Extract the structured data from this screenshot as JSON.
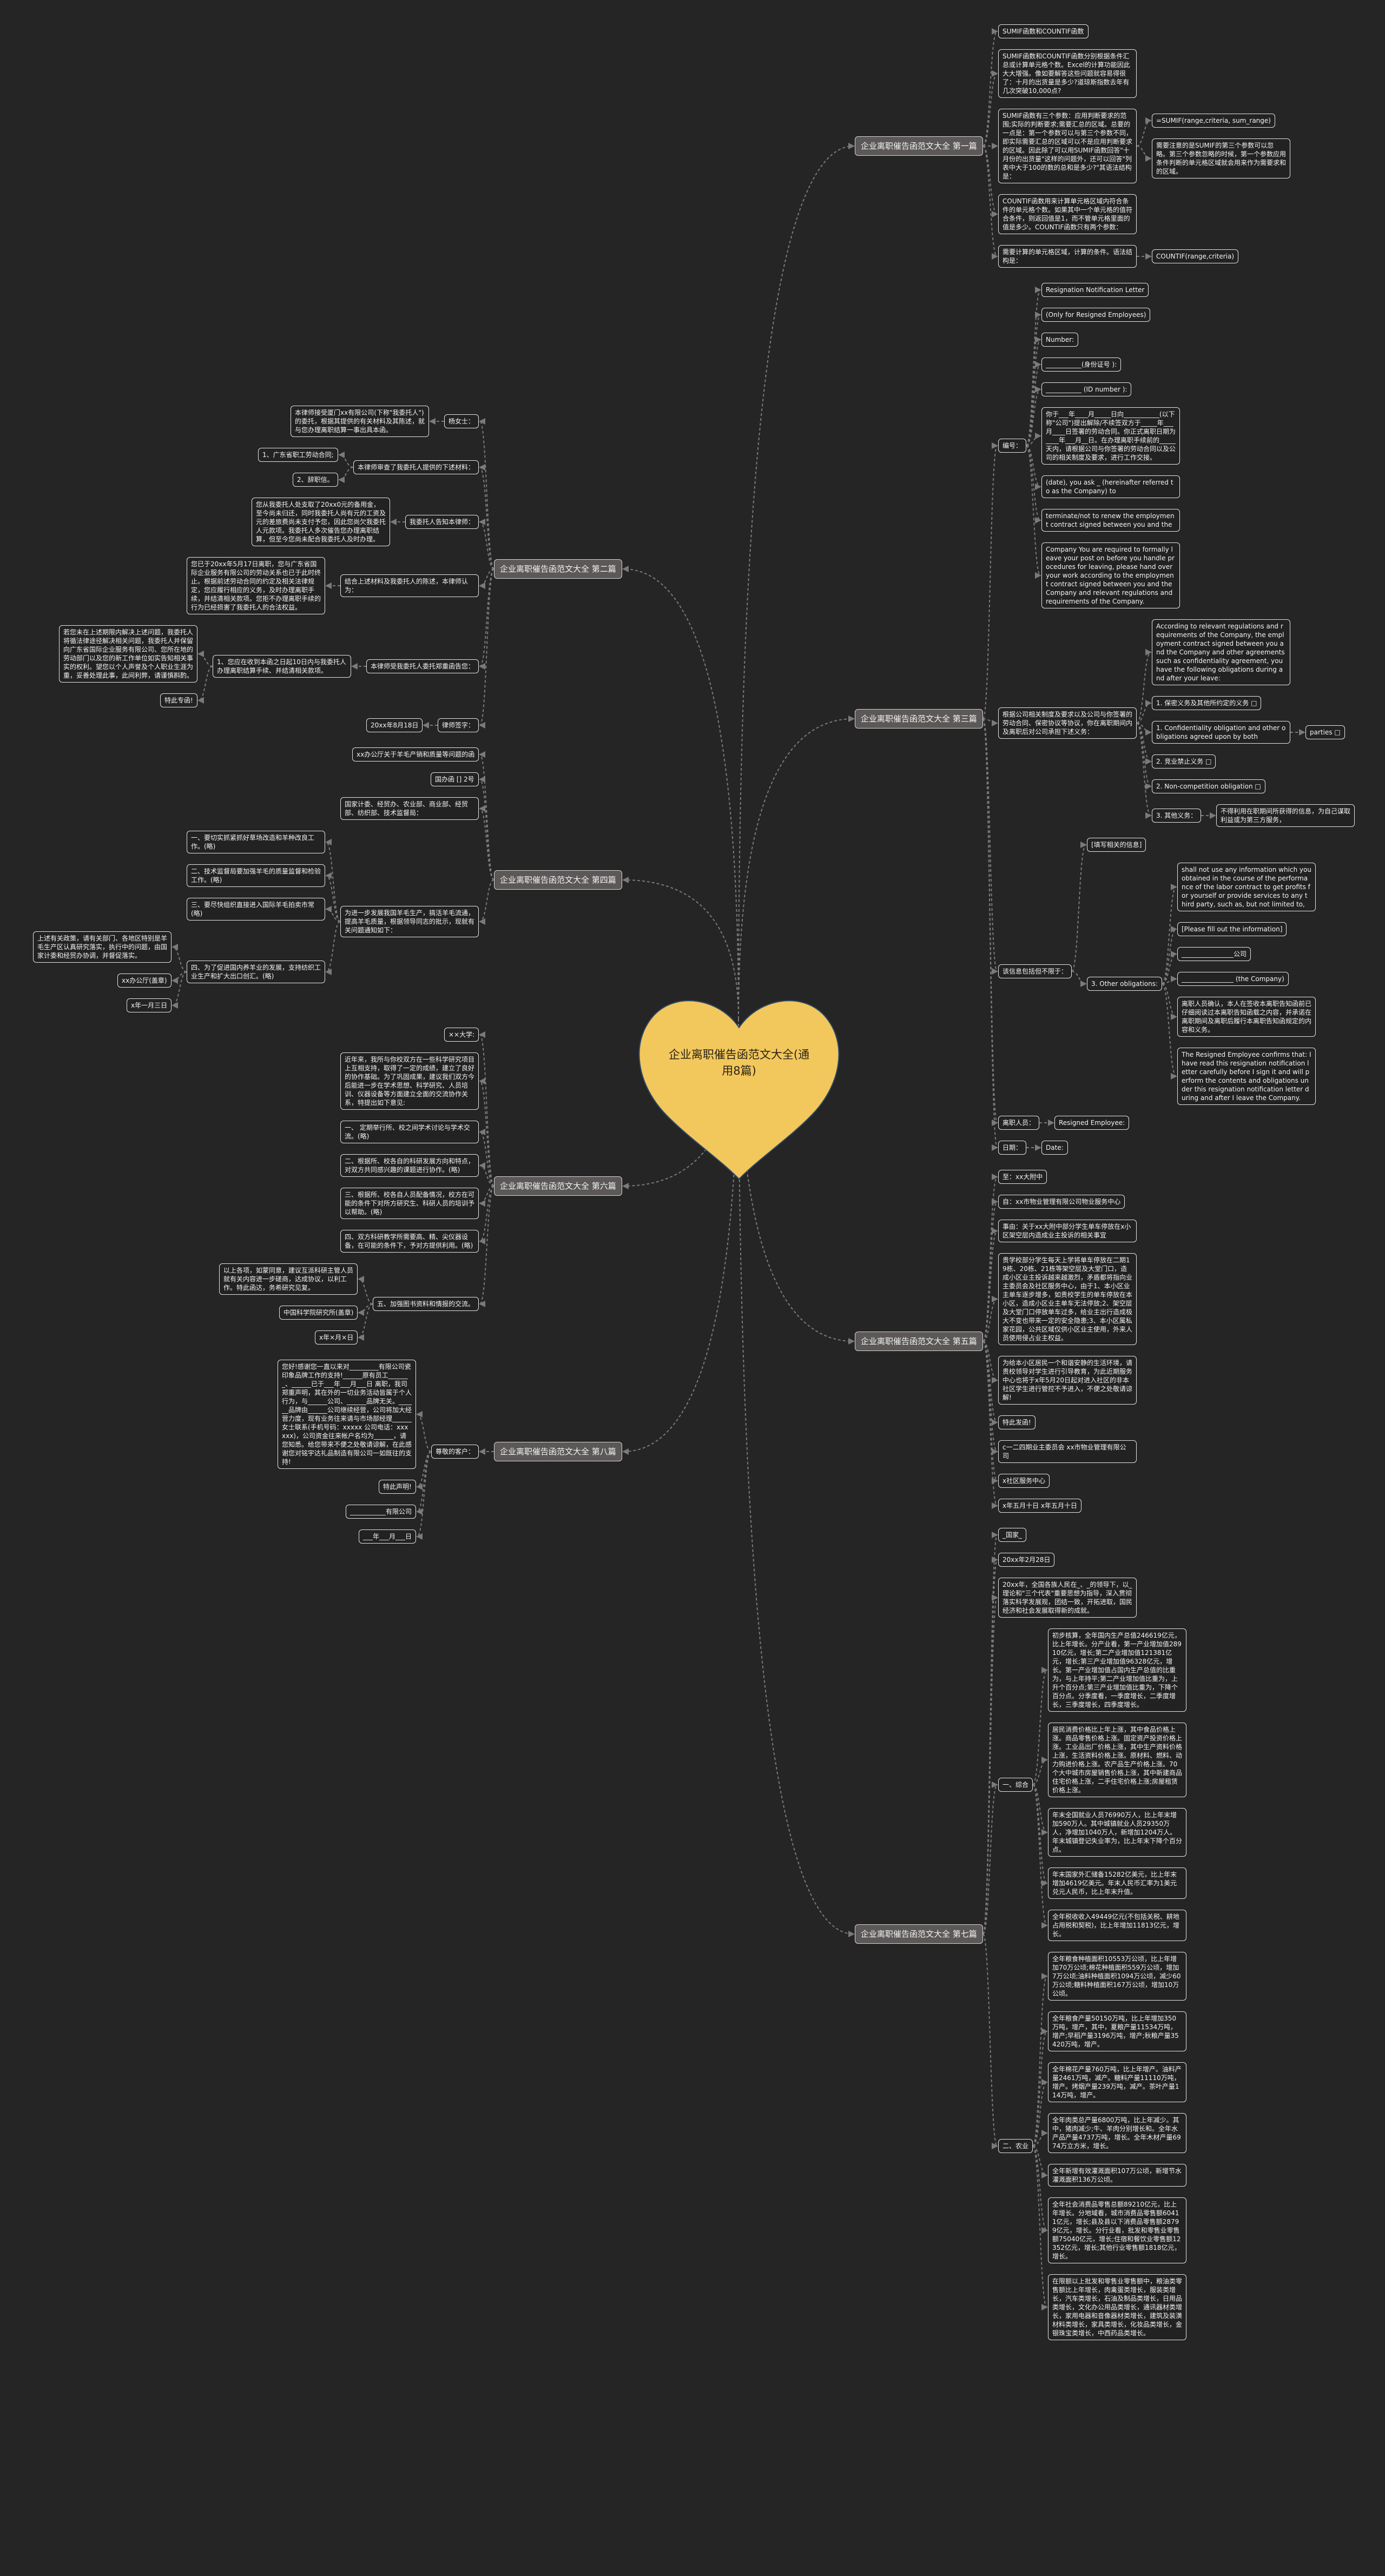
{
  "colors": {
    "background": "#252525",
    "central_fill": "#f2c75c",
    "branch_fill": "#5b5857",
    "node_border": "#e6e6e6",
    "connector": "#7a7a7a"
  },
  "mindmap": {
    "root": "企业离职催告函范文大全(通用8篇)",
    "right": [
      {
        "text": "企业离职催告函范文大全 第一篇",
        "children": [
          {
            "text": "SUMIF函数和COUNTIF函数"
          },
          {
            "text": "SUMIF函数和COUNTIF函数分别根据条件汇总或计算单元格个数。Excel的计算功能因此大大增强。像如要解答这些问题就容易得很了：十月的出货量是多少?道琼斯指数去年有几次突破10,000点?"
          },
          {
            "text": "SUMIF函数有三个参数：应用判断要求的范围;实际的判断要求;需要汇总的区域。总要的一点是：第一个参数可以与第三个参数不同，即实际需要汇总的区域可以不是应用判断要求的区域。因此除了可以用SUMIF函数回答\"十月份的出货量\"这样的问题外，还可以回答\"列表中大于100的数的总和是多少?\"其语法结构是：",
            "children": [
              {
                "text": "=SUMIF(range,criteria, sum_range)"
              },
              {
                "text": "需要注意的是SUMIF的第三个参数可以忽略。第三个参数忽略的时候，第一个参数应用条件判断的单元格区域就会用来作为需要求和的区域。"
              }
            ]
          },
          {
            "text": "COUNTIF函数用来计算单元格区域内符合条件的单元格个数。如果其中一个单元格的值符合条件，则返回值是1，而不管单元格里面的值是多少。COUNTIF函数只有两个参数："
          },
          {
            "text": "需要计算的单元格区域，计算的条件。语法结构是：",
            "children": [
              {
                "text": "COUNTIF(range,criteria)"
              }
            ]
          }
        ]
      },
      {
        "text": "企业离职催告函范文大全 第三篇",
        "children": [
          {
            "text": "编号：",
            "children": [
              {
                "text": "Resignation Notification Letter"
              },
              {
                "text": "(Only for Resigned Employees)"
              },
              {
                "text": "Number:"
              },
              {
                "text": "___________(身份证号 ):"
              },
              {
                "text": "___________ (ID number ):"
              },
              {
                "text": "你于___年____月_____日向___________(以下称\"公司\")提出解除/不续签双方于_____年___月____日签署的劳动合同。你正式离职日期为____年___月__日。在办理离职手续前的_____天内，请根据公司与你签署的劳动合同以及公司的相关制度及要求，进行工作交接。"
              },
              {
                "text": "(date), you ask _ (hereinafter referred to as the Company) to"
              },
              {
                "text": "terminate/not to renew the employment contract signed between you and the"
              },
              {
                "text": "Company You are required to formally leave your post on before you handle procedures for leaving, please hand over your work according to the employment contract signed between you and the Company and relevant regulations and requirements of the Company."
              }
            ]
          },
          {
            "text": "根据公司相关制度及要求以及公司与你签署的劳动合同、保密协议等协议，你在离职期间内及离职后对公司承担下述义务：",
            "children": [
              {
                "text": "According to relevant regulations and requirements of the Company, the employment contract signed between you and the Company and other agreements such as confidentiality agreement, you have the following obligations during and after your leave:"
              },
              {
                "text": "1. 保密义务及其他所约定的义务 □"
              },
              {
                "text": "1. Confidentiality obligation and other obligations agreed upon by both",
                "children": [
                  {
                    "text": "parties □"
                  }
                ]
              },
              {
                "text": "2. 竞业禁止义务 □"
              },
              {
                "text": "2. Non-competition obligation □"
              },
              {
                "text": "3. 其他义务：",
                "children": [
                  {
                    "text": "不得利用在职期间所获得的信息，为自己谋取利益或为第三方服务，"
                  }
                ]
              }
            ]
          },
          {
            "text": "该信息包括但不限于：",
            "children": [
              {
                "text": "[填写相关的信息]"
              },
              {
                "text": "3. Other obligations:",
                "children": [
                  {
                    "text": " shall not use any information which you obtained in the course of the performance of the labor contract to get profits for yourself or provide services to any third party, such as, but not limited to,"
                  },
                  {
                    "text": "[Please fill out the information]"
                  },
                  {
                    "text": "________________公司"
                  },
                  {
                    "text": "________________ (the Company)"
                  },
                  {
                    "text": "离职人员确认，本人在签收本离职告知函前已仔细阅读过本离职告知函载之内容，并承诺在离职期间及离职后履行本离职告知函规定的内容和义务。"
                  },
                  {
                    "text": "The Resigned Employee confirms that: I have read this resignation notification letter carefully before I sign it and will perform the contents and obligations under this resignation notification letter during and after I leave the Company."
                  }
                ]
              }
            ]
          },
          {
            "text": "离职人员：",
            "children": [
              {
                "text": "Resigned Employee:"
              }
            ]
          },
          {
            "text": "日期：",
            "children": [
              {
                "text": "Date:"
              }
            ]
          }
        ]
      },
      {
        "text": "企业离职催告函范文大全 第五篇",
        "children": [
          {
            "text": "至：xx大附中"
          },
          {
            "text": "自：xx市物业管理有限公司物业服务中心"
          },
          {
            "text": "事由：关于xx大附中部分学生单车停放在x小区架空层内造成业主投诉的相关事宜"
          },
          {
            "text": "贵学校部分学生每天上学将单车停放在二期19栋、20栋、21栋等架空层及大堂门口，造成小区业主投诉越来越激烈，矛盾都将指向业主委员会及社区服务中心，由于1、本小区业主单车逐步增多，如贵校学生的单车停放在本小区，造成小区业主单车无法停放;2、架空层及大堂门口停放单车过多，给业主出行造成极大不变也带来一定的安全隐患;3、本小区属私家花园，公共区域仅供小区业主使用，外来人员使用侵占业主权益。"
          },
          {
            "text": "为给本小区居民一个和谐安静的生活环境，请贵校领导对学生进行引导教育，为此近期服务中心也将于x年5月20日起对进入社区的非本社区学生进行管控不予进入，不便之处敬请谅解!"
          },
          {
            "text": "特此发函!"
          },
          {
            "text": "c一二四期业主委员会 xx市物业管理有限公司"
          },
          {
            "text": "x社区服务中心"
          },
          {
            "text": "x年五月十日 x年五月十日"
          }
        ]
      },
      {
        "text": "企业离职催告函范文大全 第七篇",
        "children": [
          {
            "text": "_国家_"
          },
          {
            "text": "20xx年2月28日"
          },
          {
            "text": "20xx年，全国各族人民在_、_的领导下，以_理论和\"三个代表\"重要思想为指导，深入贯彻落实科学发展观，团结一致，开拓进取，国民经济和社会发展取得新的成就。"
          },
          {
            "text": "一、综合",
            "children": [
              {
                "text": "初步核算，全年国内生产总值246619亿元，比上年增长。分产业看，第一产业增加值28910亿元，增长;第二产业增加值121381亿元，增长;第三产业增加值96328亿元，增长。第一产业增加值占国内生产总值的比重为，与上年持平;第二产业增加值比重为，上升个百分点;第三产业增加值比重为，下降个百分点。分季度看，一季度增长，二季度增长，三季度增长，四季度增长。"
              },
              {
                "text": "居民消费价格比上年上涨，其中食品价格上涨。商品零售价格上涨。固定资产投资价格上涨。工业品出厂价格上涨，其中生产资料价格上涨，生活资料价格上涨。原材料、燃料、动力购进价格上涨。农产品生产价格上涨。70个大中城市房屋销售价格上涨，其中新建商品住宅价格上涨，二手住宅价格上涨;房屋租赁价格上涨。"
              },
              {
                "text": "年末全国就业人员76990万人，比上年末增加590万人。其中城镇就业人员29350万人，净增加1040万人，新增加1204万人。年末城镇登记失业率为，比上年末下降个百分点。"
              },
              {
                "text": "年末国家外汇储备15282亿美元，比上年末增加4619亿美元。年末人民币汇率为1美元兑元人民币，比上年末升值。"
              },
              {
                "text": "全年税收收入49449亿元(不包括关税、耕地占用税和契税)，比上年增加11813亿元，增长。"
              }
            ]
          },
          {
            "text": "二、农业",
            "children": [
              {
                "text": "全年粮食种植面积10553万公顷，比上年增加70万公顷;棉花种植面积559万公顷，增加7万公顷;油料种植面积1094万公顷，减少60万公顷;糖料种植面积167万公顷，增加10万公顷。"
              },
              {
                "text": "全年粮食产量50150万吨，比上年增加350万吨，增产，其中，夏粮产量11534万吨，增产;早稻产量3196万吨，增产;秋粮产量35420万吨，增产。"
              },
              {
                "text": "全年棉花产量760万吨，比上年增产。油料产量2461万吨，减产。糖料产量11110万吨，增产。烤烟产量239万吨，减产。茶叶产量114万吨，增产。"
              },
              {
                "text": "全年肉类总产量6800万吨，比上年减少。其中，猪肉减少;牛、羊肉分别增长和。全年水产品产量4737万吨，增长。全年木材产量6974万立方米，增长。"
              },
              {
                "text": "全年新增有效灌溉面积107万公顷，新增节水灌溉面积136万公顷。"
              },
              {
                "text": "全年社会消费品零售总额89210亿元，比上年增长。分地域看，城市消费品零售额60411亿元，增长;县及县以下消费品零售额28799亿元，增长。分行业看，批发和零售业零售额75040亿元，增长;住宿和餐饮业零售额12352亿元，增长;其他行业零售额1818亿元，增长。"
              },
              {
                "text": "在限额以上批发和零售业零售额中，粮油类零售额比上年增长，肉禽蛋类增长，服装类增长，汽车类增长，石油及制品类增长，日用品类增长，文化办公用品类增长，通讯器材类增长，家用电器和音像器材类增长，建筑及装潢材料类增长，家具类增长，化妆品类增长，金银珠宝类增长，中西药品类增长。"
              }
            ]
          }
        ]
      }
    ],
    "left": [
      {
        "text": "企业离职催告函范文大全 第二篇",
        "children": [
          {
            "text": "杨女士：",
            "children": [
              {
                "text": "本律师接受厦门xx有限公司(下称\"我委托人\")的委托，根据其提供的有关材料及其陈述，就与您办理离职结算一事出具本函。"
              }
            ]
          },
          {
            "text": "本律师审查了我委托人提供的下述材料：",
            "children": [
              {
                "text": "1、广东省职工劳动合同;"
              },
              {
                "text": "2、辞职信。"
              }
            ]
          },
          {
            "text": "我委托人告知本律师：",
            "children": [
              {
                "text": "您从我委托人处支取了20xx0元的备用金，至今尚未归还，同时我委托人尚有元的工资及元的差旅费尚未支付予您，因此您尚欠我委托人元款项。我委托人多次催告您办理离职结算，但至今您尚未配合我委托人及时办理。"
              }
            ]
          },
          {
            "text": "结合上述材料及我委托人的陈述，本律师认为：",
            "children": [
              {
                "text": "您已于20xx年5月17日离职，您与广东省国际企业服务有限公司的劳动关系也已于此时终止。根据前述劳动合同的约定及相关法律规定，您应履行相应的义务，及时办理离职手续，并结清相关款项。您拒不办理离职手续的行为已经损害了我委托人的合法权益。"
              }
            ]
          },
          {
            "text": "本律师受我委托人委托郑重函告您：",
            "children": [
              {
                "text": "1、您应在收到本函之日起10日内与我委托人办理离职结算手续、并结清相关款项。",
                "children": [
                  {
                    "text": "若您未在上述期限内解决上述问题，我委托人将循法律途径解决相关问题，我委托人并保留向广东省国际企业服务有限公司、您所在地的劳动部门以及您的新工作单位如实告知相关事实的权利。望您以个人声誉及个人职业生涯为重，妥善处理此事，此间利弊，请谨慎斟酌。"
                  },
                  {
                    "text": "特此专函!"
                  }
                ]
              }
            ]
          },
          {
            "text": "律师签字：",
            "children": [
              {
                "text": "20xx年8月18日"
              }
            ]
          }
        ]
      },
      {
        "text": "企业离职催告函范文大全 第四篇",
        "children": [
          {
            "text": "xx办公厅关于羊毛产销和质量等问题的函"
          },
          {
            "text": "国办函 [] 2号"
          },
          {
            "text": "国家计委、经贸办、农业部、商业部、经贸部、纺织部、技术监督局："
          },
          {
            "text": "为进一步发展我国羊毛生产，搞活羊毛流通，提高羊毛质量，根据领导同志的批示，现就有关问题通知如下：",
            "children": [
              {
                "text": "一、要切实抓紧抓好草场改造和羊种改良工作。(略)"
              },
              {
                "text": "二、技术监督局要加强羊毛的质量监督和检验工作。(略)"
              },
              {
                "text": "三、要尽快组织直接进入国际羊毛拍卖市常(略)"
              },
              {
                "text": "四、为了促进国内养羊业的发展，支持纺织工业生产和扩大出口创汇。(略)",
                "children": [
                  {
                    "text": "上述有关政策，请有关部门、各地区特别是羊毛生产区认真研究落实，执行中的问题，由国家计委和经贸办协调，并督促落实。"
                  },
                  {
                    "text": "xx办公厅(盖章)"
                  },
                  {
                    "text": "x年一月三日"
                  }
                ]
              }
            ]
          }
        ]
      },
      {
        "text": "企业离职催告函范文大全 第六篇",
        "children": [
          {
            "text": "××大学:"
          },
          {
            "text": "近年来，我所与你校双方在一些科学研究项目上互相支持，取得了一定的成绩，建立了良好的协作基础。为了巩固成果，建议我们双方今后能进一步在学术思想、科学研究、人员培训、仪器设备等方面建立全面的交流协作关系，特提出如下意见:"
          },
          {
            "text": "一、 定期举行所、校之间学术讨论与学术交流。(略)"
          },
          {
            "text": "二、根据所、校各自的科研发展方向和特点，对双方共同感兴趣的课题进行协作。(略)"
          },
          {
            "text": "三、根据所、校各自人员配备情况，校方在可能的条件下对所方研究生、科研人员的培训予以帮助。(略)"
          },
          {
            "text": "四、双方科研教学所需要高、精、尖仪器设备，在可能的条件下，予对方提供利用。(略)"
          },
          {
            "text": "五、加强图书资料和情报的交流。",
            "children": [
              {
                "text": "以上各项，如蒙同意，建议互派科研主管人员就有关内容进一步磋商，达成协议，以利工作。特此函达，务希研究见复。"
              },
              {
                "text": "中国科学院研究所(盖章)"
              },
              {
                "text": "x年×月×日"
              }
            ]
          }
        ]
      },
      {
        "text": "企业离职催告函范文大全 第八篇",
        "children": [
          {
            "text": "尊敬的客户：",
            "children": [
              {
                "text": "您好!感谢您一直以来对_________有限公司瓷印象品牌工作的支持!______原有员工_______、______已于___年___月___日 离职，我司郑重声明，其在外的一切业务活动皆属于个人行为，与______公司、______品牌无关。______品牌由______公司继续经营，公司将加大经营力度，现有业务往来请与市场部经理______女士联系(手机号码：xxxxx 公司电话：xxxxxx)，公司资金往来帐户名均为______，请您知悉。给您带来不便之处敬请谅解，在此感谢您对铭宇达礼品制造有限公司一如既往的支持!"
              },
              {
                "text": "特此声明!"
              },
              {
                "text": "___________有限公司"
              },
              {
                "text": "___年___月___日"
              }
            ]
          }
        ]
      }
    ]
  }
}
